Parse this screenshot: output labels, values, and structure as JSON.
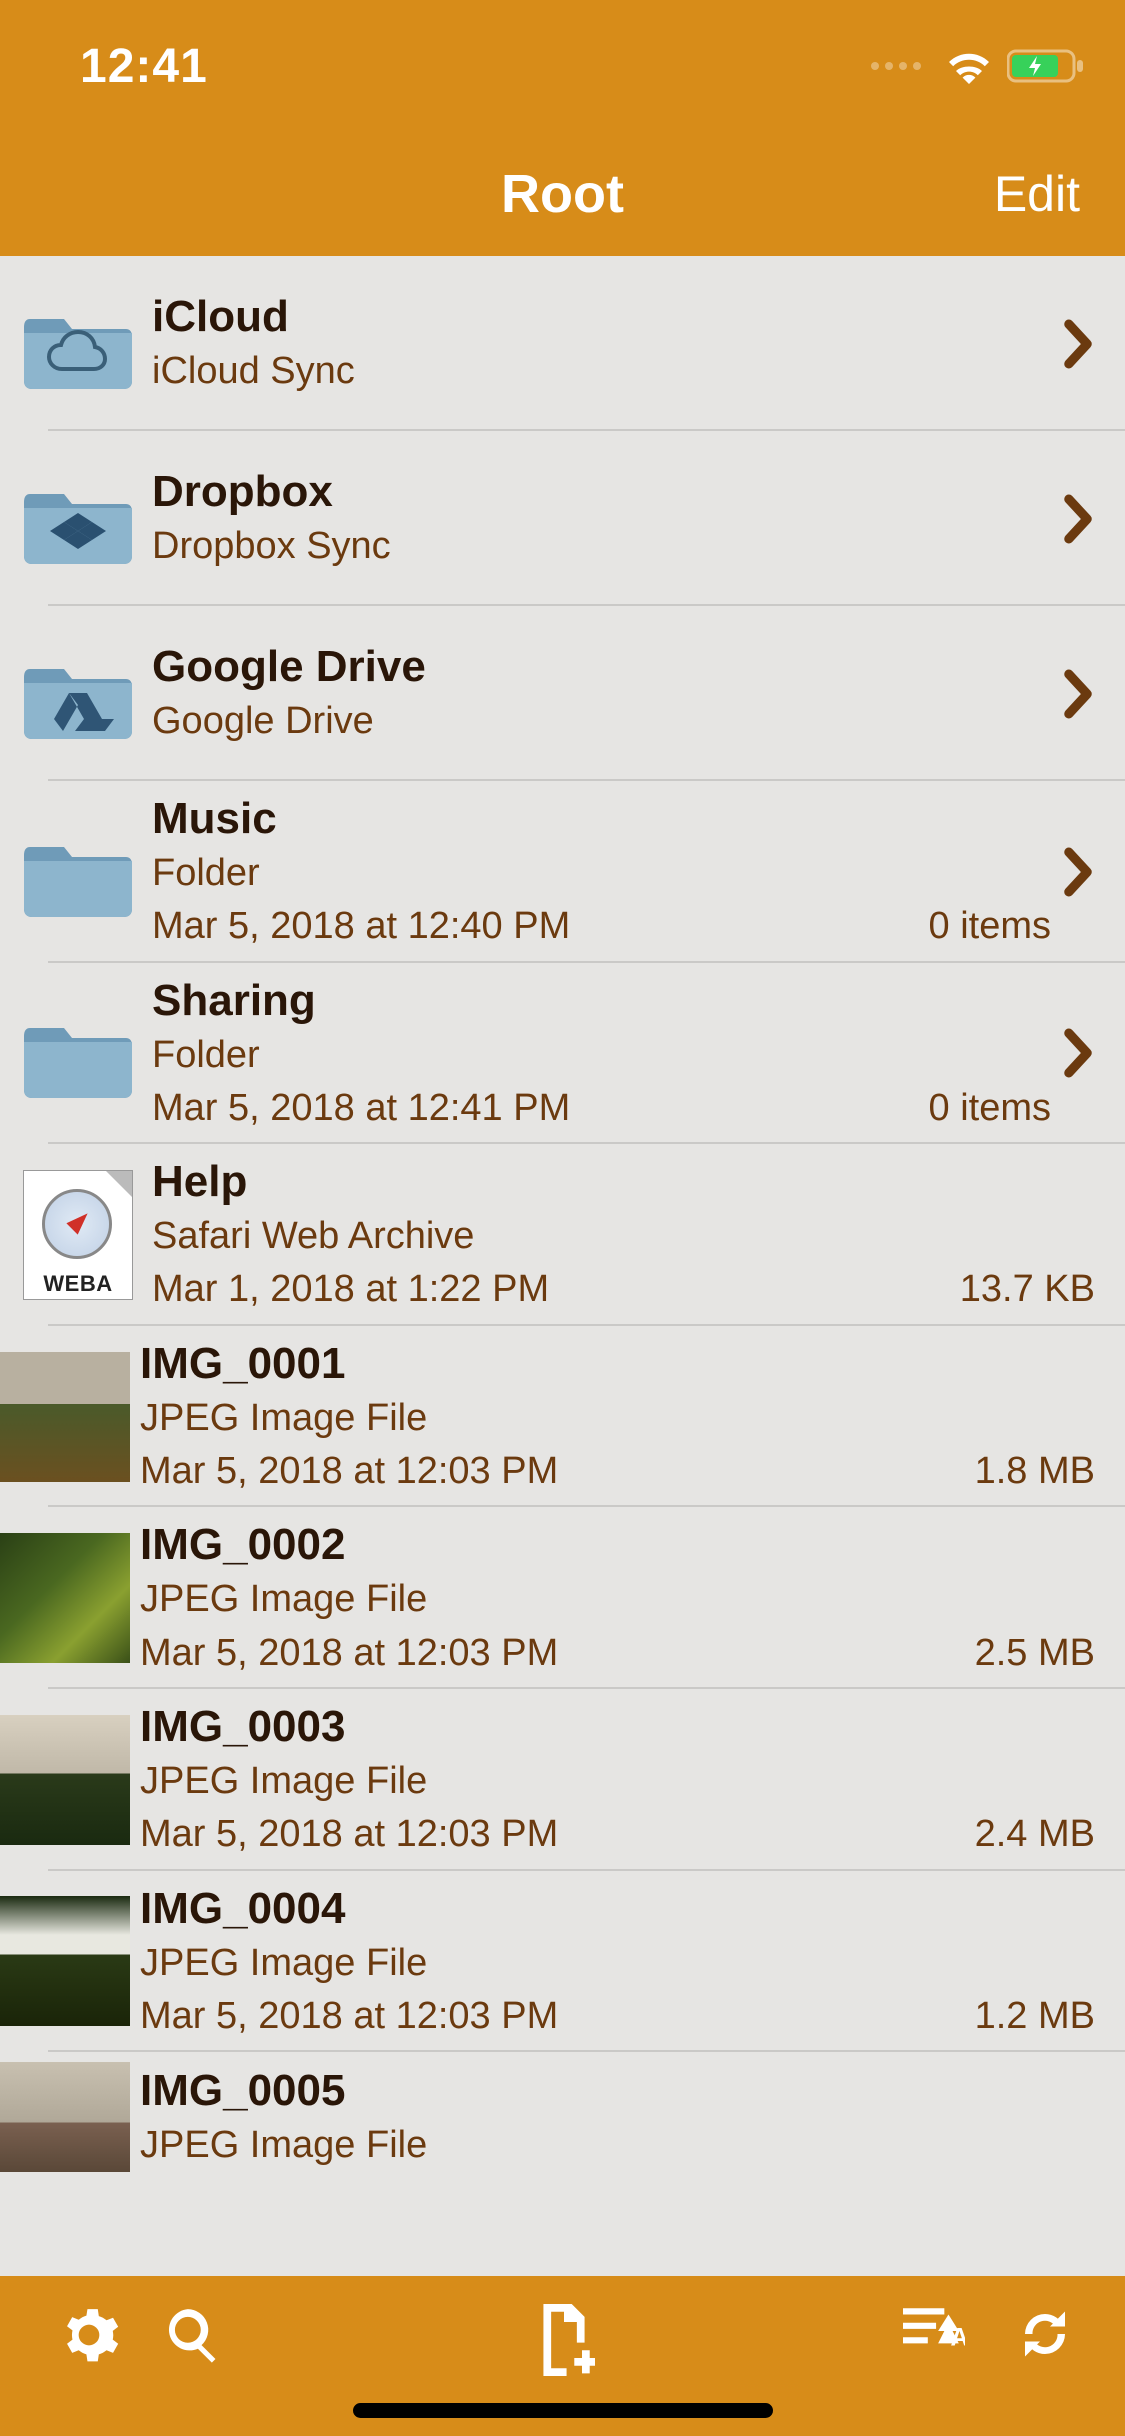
{
  "statusbar": {
    "time": "12:41"
  },
  "navbar": {
    "title": "Root",
    "edit": "Edit"
  },
  "rows": {
    "icloud": {
      "name": "iCloud",
      "sub": "iCloud Sync"
    },
    "dropbox": {
      "name": "Dropbox",
      "sub": "Dropbox Sync"
    },
    "gdrive": {
      "name": "Google Drive",
      "sub": "Google Drive"
    },
    "music": {
      "name": "Music",
      "sub": "Folder",
      "date": "Mar 5, 2018 at 12:40 PM",
      "size": "0 items"
    },
    "sharing": {
      "name": "Sharing",
      "sub": "Folder",
      "date": "Mar 5, 2018 at 12:41 PM",
      "size": "0 items"
    },
    "help": {
      "name": "Help",
      "sub": "Safari Web Archive",
      "date": "Mar 1, 2018 at 1:22 PM",
      "size": "13.7 KB",
      "badge": "WEBA"
    },
    "img1": {
      "name": "IMG_0001",
      "sub": "JPEG Image File",
      "date": "Mar 5, 2018 at 12:03 PM",
      "size": "1.8 MB"
    },
    "img2": {
      "name": "IMG_0002",
      "sub": "JPEG Image File",
      "date": "Mar 5, 2018 at 12:03 PM",
      "size": "2.5 MB"
    },
    "img3": {
      "name": "IMG_0003",
      "sub": "JPEG Image File",
      "date": "Mar 5, 2018 at 12:03 PM",
      "size": "2.4 MB"
    },
    "img4": {
      "name": "IMG_0004",
      "sub": "JPEG Image File",
      "date": "Mar 5, 2018 at 12:03 PM",
      "size": "1.2 MB"
    },
    "img5": {
      "name": "IMG_0005",
      "sub": "JPEG Image File"
    }
  }
}
